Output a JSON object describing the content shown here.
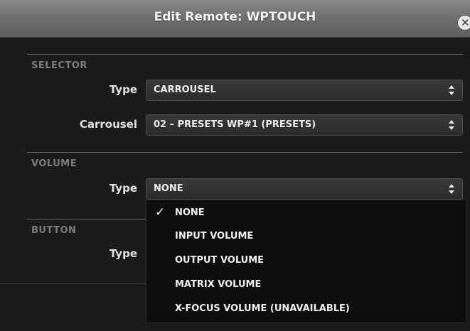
{
  "window": {
    "title": "Edit Remote: WPTOUCH",
    "close_glyph": "✕"
  },
  "selector": {
    "section_label": "SELECTOR",
    "type_label": "Type",
    "type_value": "CARROUSEL",
    "carrousel_label": "Carrousel",
    "carrousel_value": "02 – PRESETS WP#1 (PRESETS)"
  },
  "volume": {
    "section_label": "VOLUME",
    "type_label": "Type",
    "type_value": "NONE"
  },
  "button": {
    "section_label": "BUTTON",
    "type_label": "Type"
  },
  "volume_type_dropdown": {
    "check_glyph": "✓",
    "options": [
      {
        "label": "NONE",
        "selected": true
      },
      {
        "label": "INPUT VOLUME",
        "selected": false
      },
      {
        "label": "OUTPUT VOLUME",
        "selected": false
      },
      {
        "label": "MATRIX VOLUME",
        "selected": false
      },
      {
        "label": "X-FOCUS VOLUME (UNAVAILABLE)",
        "selected": false
      }
    ]
  },
  "icons": [
    "close-icon",
    "updown-arrows-icon",
    "checkmark-icon"
  ]
}
